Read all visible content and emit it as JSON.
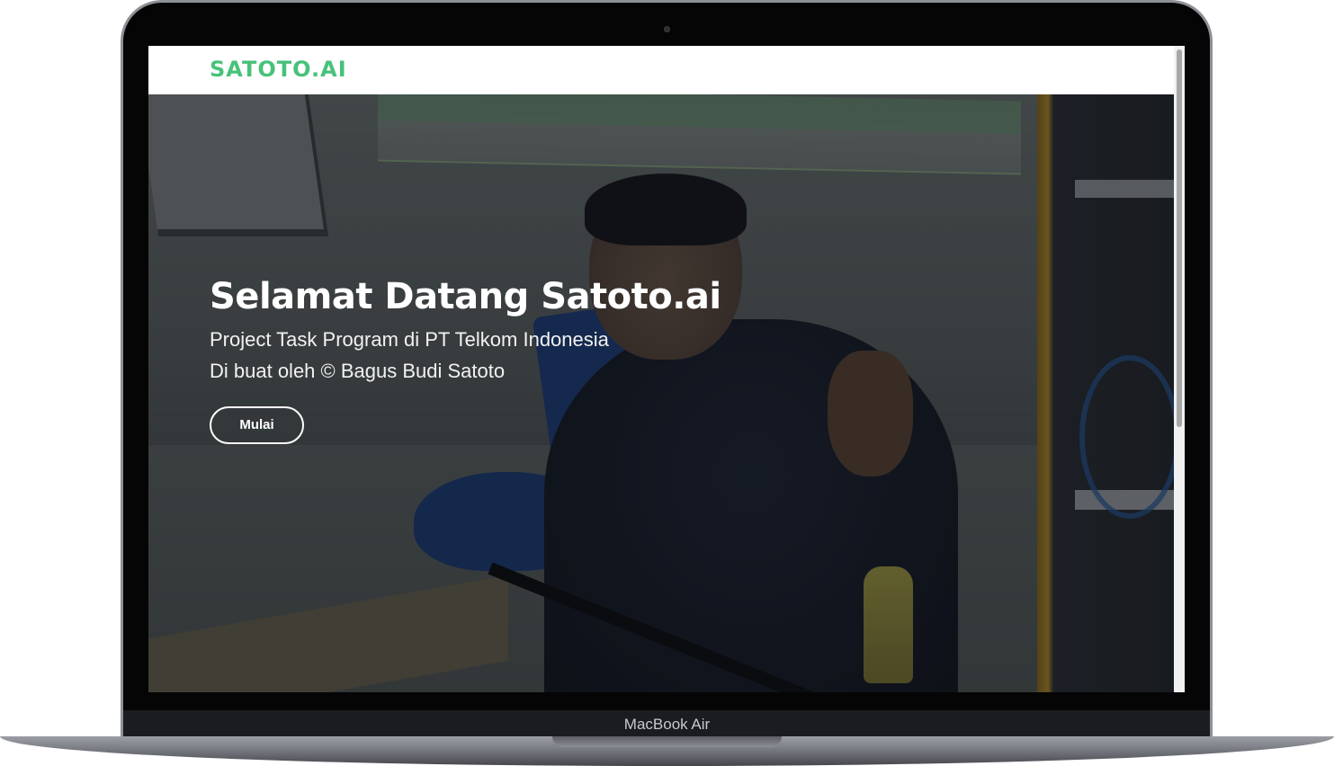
{
  "device": {
    "model_label": "MacBook Air"
  },
  "navbar": {
    "brand": "SATOTO.AI"
  },
  "hero": {
    "title": "Selamat Datang Satoto.ai",
    "subtitle_line1": "Project Task Program di PT Telkom Indonesia",
    "subtitle_line2": "Di buat oleh © Bagus Budi Satoto",
    "button_label": "Mulai"
  },
  "colors": {
    "brand": "#47c27a",
    "hero_text": "#ffffff"
  }
}
